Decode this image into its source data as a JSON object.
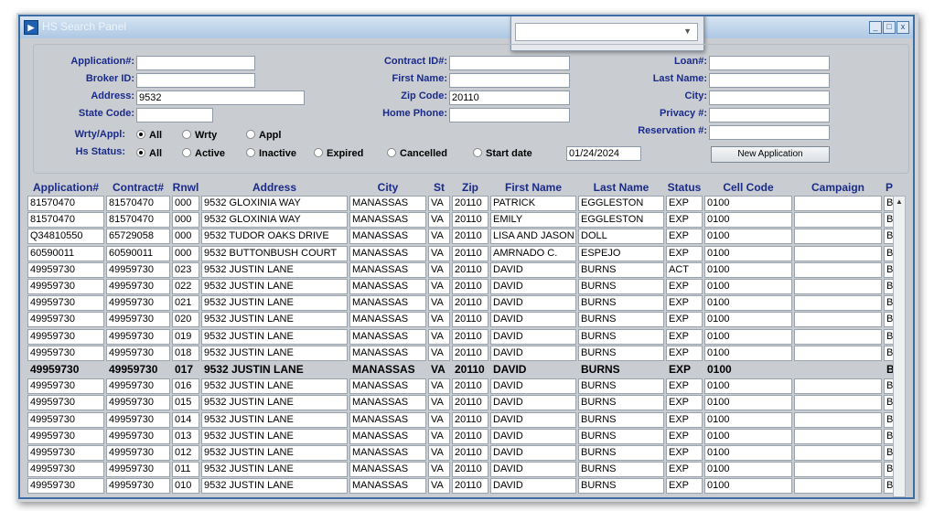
{
  "window": {
    "title": "HS Search Panel",
    "minimize": "_",
    "maximize": "□",
    "close": "x"
  },
  "form": {
    "application_label": "Application#:",
    "application_value": "",
    "broker_label": "Broker ID:",
    "broker_value": "",
    "address_label": "Address:",
    "address_value": "9532",
    "state_label": "State Code:",
    "state_value": "",
    "contract_label": "Contract ID#:",
    "contract_value": "",
    "first_name_label": "First Name:",
    "first_name_value": "",
    "zip_label": "Zip Code:",
    "zip_value": "20110",
    "home_phone_label": "Home Phone:",
    "home_phone_value": "",
    "loan_label": "Loan#:",
    "loan_value": "",
    "last_name_label": "Last Name:",
    "last_name_value": "",
    "city_label": "City:",
    "city_value": "",
    "privacy_label": "Privacy #:",
    "privacy_value": "",
    "reservation_label": "Reservation #:",
    "reservation_value": "",
    "wrty_label": "Wrty/Appl:",
    "wrty_options": [
      "All",
      "Wrty",
      "Appl"
    ],
    "status_label": "Hs Status:",
    "status_options": [
      "All",
      "Active",
      "Inactive",
      "Expired",
      "Cancelled",
      "Start date"
    ],
    "start_date_value": "01/24/2024",
    "new_application_label": "New Application"
  },
  "table": {
    "columns": [
      "Application#",
      "Contract#",
      "Rnwl",
      "Address",
      "City",
      "St",
      "Zip",
      "First Name",
      "Last Name",
      "Status",
      "Cell Code",
      "Campaign",
      "P"
    ],
    "rows": [
      [
        "81570470",
        "81570470",
        "000",
        "9532 GLOXINIA WAY",
        "MANASSAS",
        "VA",
        "20110",
        "PATRICK",
        "EGGLESTON",
        "EXP",
        "0100",
        "",
        "BI"
      ],
      [
        "81570470",
        "81570470",
        "000",
        "9532 GLOXINIA WAY",
        "MANASSAS",
        "VA",
        "20110",
        "EMILY",
        "EGGLESTON",
        "EXP",
        "0100",
        "",
        "BI"
      ],
      [
        "Q34810550",
        "65729058",
        "000",
        "9532 TUDOR OAKS DRIVE",
        "MANASSAS",
        "VA",
        "20110",
        "LISA AND JASON",
        "DOLL",
        "EXP",
        "0100",
        "",
        "BI"
      ],
      [
        "60590011",
        "60590011",
        "000",
        "9532 BUTTONBUSH COURT",
        "MANASSAS",
        "VA",
        "20110",
        "AMRNADO C.",
        "ESPEJO",
        "EXP",
        "0100",
        "",
        "BI"
      ],
      [
        "49959730",
        "49959730",
        "023",
        "9532 JUSTIN LANE",
        "MANASSAS",
        "VA",
        "20110",
        "DAVID",
        "BURNS",
        "ACT",
        "0100",
        "",
        "BI"
      ],
      [
        "49959730",
        "49959730",
        "022",
        "9532 JUSTIN LANE",
        "MANASSAS",
        "VA",
        "20110",
        "DAVID",
        "BURNS",
        "EXP",
        "0100",
        "",
        "BI"
      ],
      [
        "49959730",
        "49959730",
        "021",
        "9532 JUSTIN LANE",
        "MANASSAS",
        "VA",
        "20110",
        "DAVID",
        "BURNS",
        "EXP",
        "0100",
        "",
        "BI"
      ],
      [
        "49959730",
        "49959730",
        "020",
        "9532 JUSTIN LANE",
        "MANASSAS",
        "VA",
        "20110",
        "DAVID",
        "BURNS",
        "EXP",
        "0100",
        "",
        "BI"
      ],
      [
        "49959730",
        "49959730",
        "019",
        "9532 JUSTIN LANE",
        "MANASSAS",
        "VA",
        "20110",
        "DAVID",
        "BURNS",
        "EXP",
        "0100",
        "",
        "BI"
      ],
      [
        "49959730",
        "49959730",
        "018",
        "9532 JUSTIN LANE",
        "MANASSAS",
        "VA",
        "20110",
        "DAVID",
        "BURNS",
        "EXP",
        "0100",
        "",
        "BI"
      ],
      [
        "49959730",
        "49959730",
        "017",
        "9532 JUSTIN LANE",
        "MANASSAS",
        "VA",
        "20110",
        "DAVID",
        "BURNS",
        "EXP",
        "0100",
        "",
        "BI"
      ],
      [
        "49959730",
        "49959730",
        "016",
        "9532 JUSTIN LANE",
        "MANASSAS",
        "VA",
        "20110",
        "DAVID",
        "BURNS",
        "EXP",
        "0100",
        "",
        "BI"
      ],
      [
        "49959730",
        "49959730",
        "015",
        "9532 JUSTIN LANE",
        "MANASSAS",
        "VA",
        "20110",
        "DAVID",
        "BURNS",
        "EXP",
        "0100",
        "",
        "BI"
      ],
      [
        "49959730",
        "49959730",
        "014",
        "9532 JUSTIN LANE",
        "MANASSAS",
        "VA",
        "20110",
        "DAVID",
        "BURNS",
        "EXP",
        "0100",
        "",
        "BI"
      ],
      [
        "49959730",
        "49959730",
        "013",
        "9532 JUSTIN LANE",
        "MANASSAS",
        "VA",
        "20110",
        "DAVID",
        "BURNS",
        "EXP",
        "0100",
        "",
        "BI"
      ],
      [
        "49959730",
        "49959730",
        "012",
        "9532 JUSTIN LANE",
        "MANASSAS",
        "VA",
        "20110",
        "DAVID",
        "BURNS",
        "EXP",
        "0100",
        "",
        "BI"
      ],
      [
        "49959730",
        "49959730",
        "011",
        "9532 JUSTIN LANE",
        "MANASSAS",
        "VA",
        "20110",
        "DAVID",
        "BURNS",
        "EXP",
        "0100",
        "",
        "BI"
      ],
      [
        "49959730",
        "49959730",
        "010",
        "9532 JUSTIN LANE",
        "MANASSAS",
        "VA",
        "20110",
        "DAVID",
        "BURNS",
        "EXP",
        "0100",
        "",
        "BI"
      ]
    ],
    "highlighted_row": 10
  }
}
